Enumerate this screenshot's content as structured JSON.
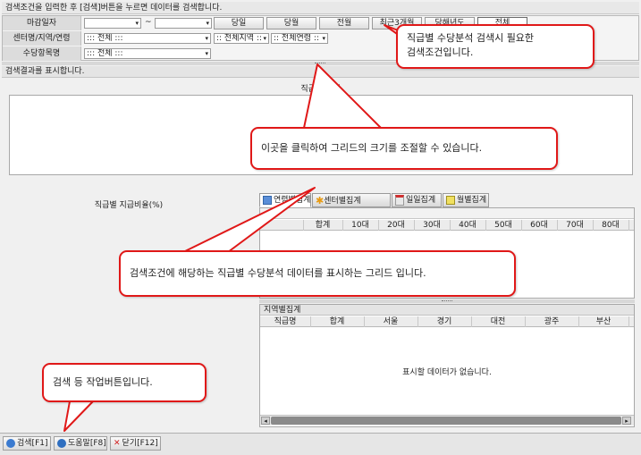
{
  "hint_text": "검색조건을 입력한 후 [검색]버튼을 누르면 데이터를 검색합니다.",
  "conditions": {
    "closing_date_label": "마감일자",
    "range_separator": "~",
    "period_buttons": [
      "당일",
      "당월",
      "전월",
      "최근3개월",
      "당해년도",
      "전체"
    ],
    "center_label": "센터명/지역/연령",
    "center_value": "::: 전체 :::",
    "region_value": ":: 전체지역 ::",
    "age_value": ":: 전체연령 ::",
    "item_label": "수당항목명",
    "item_value": "::: 전체 :::"
  },
  "result_header": "검색결과를 표시합니다.",
  "grade_total_title": "직급별 합계",
  "ratio_label": "직급별 지급비율(%)",
  "tabs": [
    {
      "label": "연령별집계",
      "icon": "grid-icon"
    },
    {
      "label": "센터별집계",
      "icon": "star-icon"
    },
    {
      "label": "일일집계",
      "icon": "calendar-icon"
    },
    {
      "label": "월별집계",
      "icon": "calendar-month-icon"
    }
  ],
  "age_grid_columns": [
    "합계",
    "10대",
    "20대",
    "30대",
    "40대",
    "50대",
    "60대",
    "70대",
    "80대"
  ],
  "region_panel": {
    "title": "지역별집계",
    "columns": [
      "직급명",
      "합계",
      "서울",
      "경기",
      "대전",
      "광주",
      "부산"
    ],
    "empty_text": "표시할 데이터가 없습니다."
  },
  "footer_buttons": [
    {
      "label": "검색[F1]",
      "icon": "search-icon",
      "color": "#3b7bd0"
    },
    {
      "label": "도움말[F8]",
      "icon": "help-icon",
      "color": "#2f6fc0"
    },
    {
      "label": "닫기[F12]",
      "icon": "close-icon",
      "color": "#d02020"
    }
  ],
  "callouts": {
    "search_conditions": "직급별 수당분석 검색시 필요한\n검색조건입니다.",
    "resize_grid": "이곳을 클릭하여 그리드의 크기를 조절할 수 있습니다.",
    "result_grid": "검색조건에 해당하는 직급별 수당분석 데이터를 표시하는 그리드 입니다.",
    "action_buttons": "검색 등 작업버튼입니다."
  }
}
